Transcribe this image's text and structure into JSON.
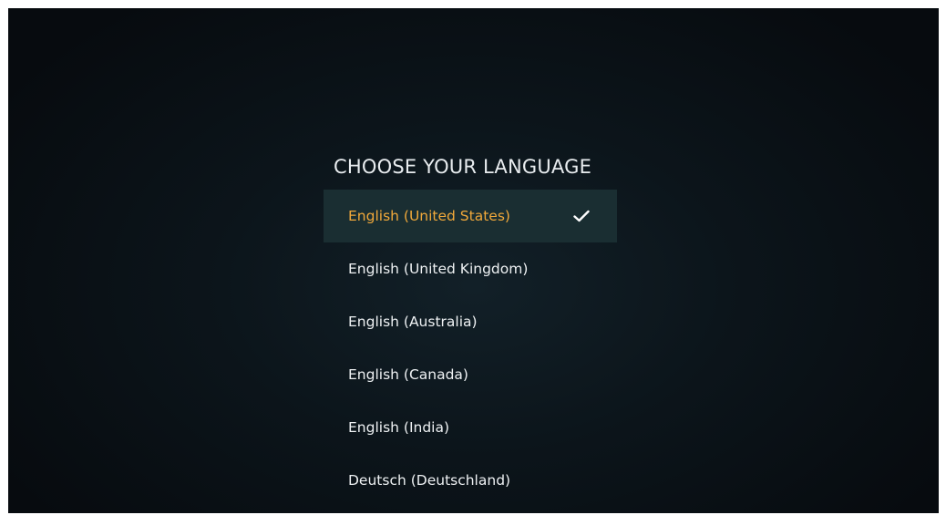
{
  "heading": "CHOOSE YOUR LANGUAGE",
  "languages": [
    {
      "label": "English (United States)",
      "selected": true
    },
    {
      "label": "English (United Kingdom)",
      "selected": false
    },
    {
      "label": "English (Australia)",
      "selected": false
    },
    {
      "label": "English (Canada)",
      "selected": false
    },
    {
      "label": "English (India)",
      "selected": false
    },
    {
      "label": "Deutsch (Deutschland)",
      "selected": false
    }
  ],
  "icons": {
    "selected_marker": "checkmark-icon"
  },
  "colors": {
    "background": "#0c151b",
    "selected_row_bg": "#1a2e32",
    "selected_text": "#f0a83a",
    "text": "#eef1f3"
  }
}
